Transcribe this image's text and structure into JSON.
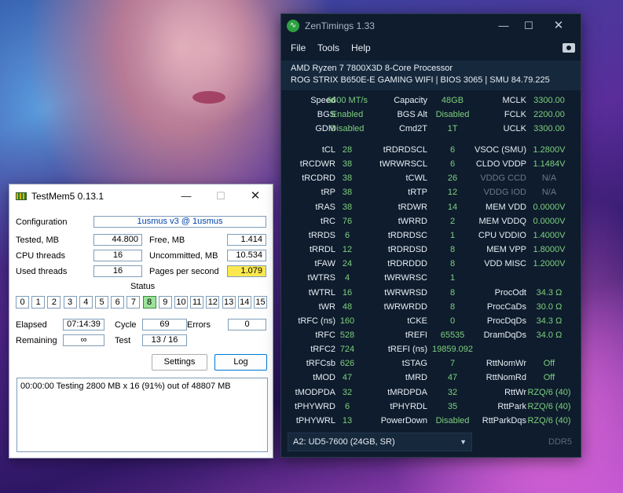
{
  "testmem": {
    "title": "TestMem5  0.13.1",
    "configuration_label": "Configuration",
    "configuration_value": "1usmus v3 @ 1usmus",
    "tested_label": "Tested, MB",
    "tested_value": "44.800",
    "free_label": "Free, MB",
    "free_value": "1.414",
    "cpu_threads_label": "CPU threads",
    "cpu_threads_value": "16",
    "uncommitted_label": "Uncommitted, MB",
    "uncommitted_value": "10.534",
    "used_threads_label": "Used threads",
    "used_threads_value": "16",
    "pages_label": "Pages per second",
    "pages_value": "1.079",
    "status_label": "Status",
    "status_cells": [
      "0",
      "1",
      "2",
      "3",
      "4",
      "5",
      "6",
      "7",
      "8",
      "9",
      "10",
      "11",
      "12",
      "13",
      "14",
      "15"
    ],
    "active_cell": 8,
    "elapsed_label": "Elapsed",
    "elapsed_value": "07:14:39",
    "cycle_label": "Cycle",
    "cycle_value": "69",
    "errors_label": "Errors",
    "errors_value": "0",
    "remaining_label": "Remaining",
    "remaining_value": "∞",
    "test_label": "Test",
    "test_value": "13 / 16",
    "settings_button": "Settings",
    "log_button": "Log",
    "log_text": "00:00:00  Testing 2800 MB x 16 (91%) out of 48807 MB"
  },
  "zen": {
    "title": "ZenTimings 1.33",
    "menu": [
      "File",
      "Tools",
      "Help"
    ],
    "cpu": "AMD Ryzen 7 7800X3D 8-Core Processor",
    "board": "ROG STRIX B650E-E GAMING WIFI | BIOS 3065 | SMU 84.79.225",
    "top_rows": [
      [
        [
          "Speed",
          "6600 MT/s"
        ],
        [
          "Capacity",
          "48GB"
        ],
        [
          "MCLK",
          "3300.00"
        ]
      ],
      [
        [
          "BGS",
          "Enabled"
        ],
        [
          "BGS Alt",
          "Disabled"
        ],
        [
          "FCLK",
          "2200.00"
        ]
      ],
      [
        [
          "GDM",
          "Disabled"
        ],
        [
          "Cmd2T",
          "1T"
        ],
        [
          "UCLK",
          "3300.00"
        ]
      ]
    ],
    "timing_rows": [
      [
        [
          "tCL",
          "28"
        ],
        [
          "tRDRDSCL",
          "6"
        ],
        [
          "VSOC (SMU)",
          "1.2800V"
        ]
      ],
      [
        [
          "tRCDWR",
          "38"
        ],
        [
          "tWRWRSCL",
          "6"
        ],
        [
          "CLDO VDDP",
          "1.1484V"
        ]
      ],
      [
        [
          "tRCDRD",
          "38"
        ],
        [
          "tCWL",
          "26"
        ],
        [
          "VDDG CCD",
          "N/A"
        ]
      ],
      [
        [
          "tRP",
          "38"
        ],
        [
          "tRTP",
          "12"
        ],
        [
          "VDDG IOD",
          "N/A"
        ]
      ],
      [
        [
          "tRAS",
          "38"
        ],
        [
          "tRDWR",
          "14"
        ],
        [
          "MEM VDD",
          "0.0000V"
        ]
      ],
      [
        [
          "tRC",
          "76"
        ],
        [
          "tWRRD",
          "2"
        ],
        [
          "MEM VDDQ",
          "0.0000V"
        ]
      ],
      [
        [
          "tRRDS",
          "6"
        ],
        [
          "tRDRDSC",
          "1"
        ],
        [
          "CPU VDDIO",
          "1.4000V"
        ]
      ],
      [
        [
          "tRRDL",
          "12"
        ],
        [
          "tRDRDSD",
          "8"
        ],
        [
          "MEM VPP",
          "1.8000V"
        ]
      ],
      [
        [
          "tFAW",
          "24"
        ],
        [
          "tRDRDDD",
          "8"
        ],
        [
          "VDD MISC",
          "1.2000V"
        ]
      ],
      [
        [
          "tWTRS",
          "4"
        ],
        [
          "tWRWRSC",
          "1"
        ],
        [
          "",
          ""
        ]
      ],
      [
        [
          "tWTRL",
          "16"
        ],
        [
          "tWRWRSD",
          "8"
        ],
        [
          "ProcOdt",
          "34.3 Ω"
        ]
      ],
      [
        [
          "tWR",
          "48"
        ],
        [
          "tWRWRDD",
          "8"
        ],
        [
          "ProcCaDs",
          "30.0 Ω"
        ]
      ],
      [
        [
          "tRFC (ns)",
          "160"
        ],
        [
          "tCKE",
          "0"
        ],
        [
          "ProcDqDs",
          "34.3 Ω"
        ]
      ],
      [
        [
          "tRFC",
          "528"
        ],
        [
          "tREFI",
          "65535"
        ],
        [
          "DramDqDs",
          "34.0 Ω"
        ]
      ],
      [
        [
          "tRFC2",
          "724"
        ],
        [
          "tREFI (ns)",
          "19859.092"
        ],
        [
          "",
          ""
        ]
      ],
      [
        [
          "tRFCsb",
          "626"
        ],
        [
          "tSTAG",
          "7"
        ],
        [
          "RttNomWr",
          "Off"
        ]
      ],
      [
        [
          "tMOD",
          "47"
        ],
        [
          "tMRD",
          "47"
        ],
        [
          "RttNomRd",
          "Off"
        ]
      ],
      [
        [
          "tMODPDA",
          "32"
        ],
        [
          "tMRDPDA",
          "32"
        ],
        [
          "RttWr",
          "RZQ/6 (40)"
        ]
      ],
      [
        [
          "tPHYWRD",
          "6"
        ],
        [
          "tPHYRDL",
          "35"
        ],
        [
          "RttPark",
          "RZQ/6 (40)"
        ]
      ],
      [
        [
          "tPHYWRL",
          "13"
        ],
        [
          "PowerDown",
          "Disabled"
        ],
        [
          "RttParkDqs",
          "RZQ/6 (40)"
        ]
      ]
    ],
    "dim_labels": [
      "VDDG CCD",
      "VDDG IOD"
    ],
    "dropdown_value": "A2: UD5-7600 (24GB, SR)",
    "ddr_label": "DDR5"
  }
}
